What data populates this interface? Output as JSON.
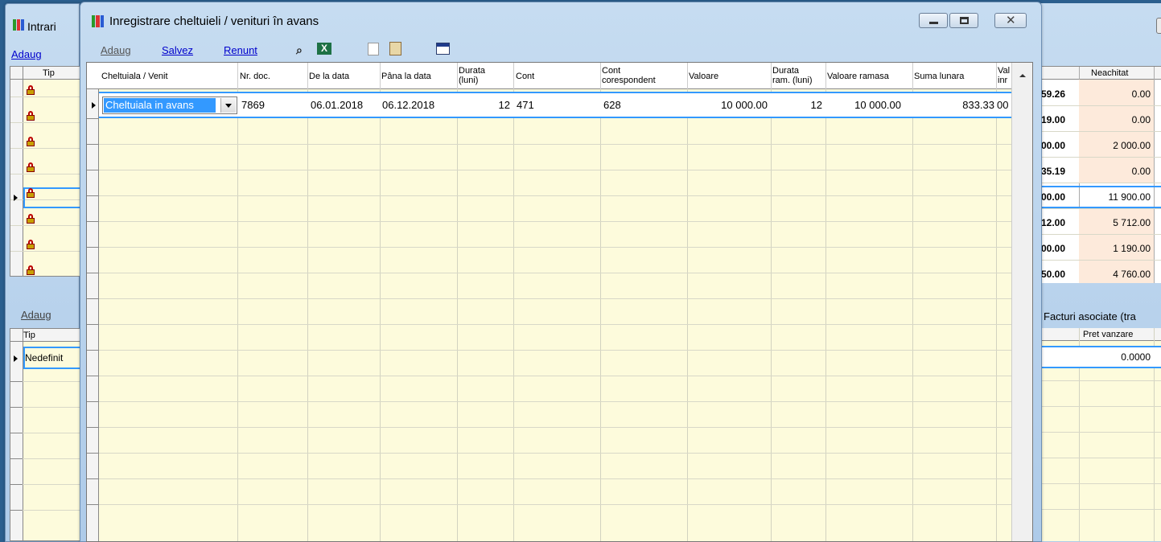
{
  "colors": {
    "accent": "#0000cc",
    "cream": "#fdfbdc",
    "selection": "#3399ff",
    "peach": "#fdeadb"
  },
  "bg_window": {
    "title": "Intrari",
    "add_label": "Adaug",
    "col_tip": "Tip",
    "rows_count": 8,
    "right_header": "Neachitat",
    "right_values": [
      {
        "partial": "59.26",
        "neachitat": "0.00"
      },
      {
        "partial": "19.00",
        "neachitat": "0.00"
      },
      {
        "partial": "00.00",
        "neachitat": "2 000.00"
      },
      {
        "partial": "35.19",
        "neachitat": "0.00"
      },
      {
        "partial": "00.00",
        "neachitat": "11 900.00"
      },
      {
        "partial": "12.00",
        "neachitat": "5 712.00"
      },
      {
        "partial": "00.00",
        "neachitat": "1 190.00"
      },
      {
        "partial": "50.00",
        "neachitat": "4 760.00"
      }
    ],
    "lower_add_label": "Adaug",
    "lower_col_tip": "Tip",
    "lower_row_value": "Nedefinit",
    "facturi_label": "Facturi asociate (tra",
    "pret_header": "Pret vanzare",
    "pret_value": "0.0000"
  },
  "dialog": {
    "title": "Inregistrare cheltuieli / venituri în avans",
    "toolbar": {
      "add": "Adaug",
      "save": "Salvez",
      "cancel": "Renunt"
    },
    "headers": {
      "cheltuiala": "Cheltuiala / Venit",
      "nr_doc": "Nr. doc.",
      "de_la": "De la data",
      "pana_la": "Pâna la data",
      "durata_1": "Durata",
      "durata_2": "(luni)",
      "cont": "Cont",
      "cont_cor_1": "Cont",
      "cont_cor_2": "corespondent",
      "valoare": "Valoare",
      "durata_ram_1": "Durata",
      "durata_ram_2": "ram. (luni)",
      "valoare_ramasa": "Valoare ramasa",
      "suma_lunara": "Suma lunara",
      "val_inr_1": "Val",
      "val_inr_2": "inr"
    },
    "row": {
      "cheltuiala": "Cheltuiala in avans",
      "nr_doc": "7869",
      "de_la": "06.01.2018",
      "pana_la": "06.12.2018",
      "durata": "12",
      "cont": "471",
      "cont_cor": "628",
      "valoare": "10 000.00",
      "durata_ram": "12",
      "valoare_ramasa": "10 000.00",
      "suma_lunara": "833.33",
      "val_inr": "00"
    }
  }
}
